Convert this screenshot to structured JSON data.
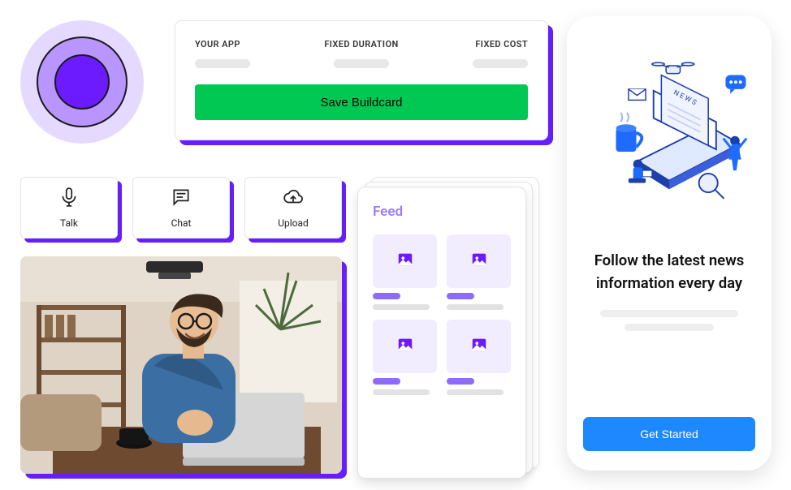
{
  "buildcard": {
    "col1_label": "YOUR APP",
    "col2_label": "FIXED DURATION",
    "col3_label": "FIXED COST",
    "save_label": "Save Buildcard"
  },
  "actions": {
    "talk": "Talk",
    "chat": "Chat",
    "upload": "Upload"
  },
  "feed": {
    "title": "Feed"
  },
  "phone": {
    "headline": "Follow the latest news information every day",
    "cta": "Get Started"
  }
}
